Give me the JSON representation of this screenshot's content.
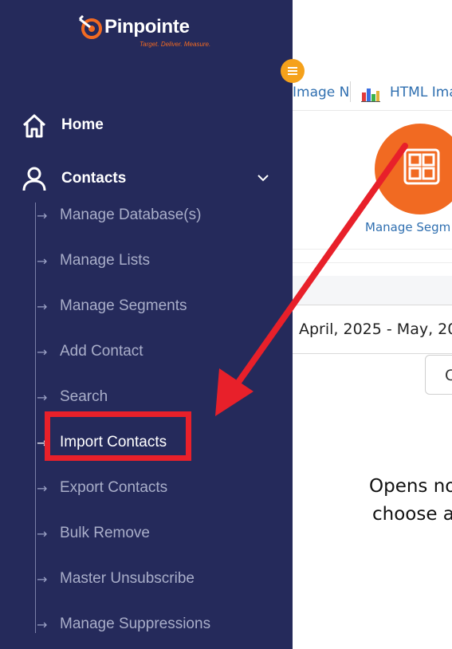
{
  "brand": {
    "name": "Pinpointe",
    "tagline": "Target. Deliver. Measure.",
    "accent_color": "#f16a22"
  },
  "sidebar": {
    "background_color": "#252a5b",
    "collapse_icon": "hamburger-icon",
    "main_items": [
      {
        "label": "Home",
        "icon": "home-icon"
      },
      {
        "label": "Contacts",
        "icon": "user-icon",
        "expanded": true,
        "chevron": "chevron-down-icon"
      }
    ],
    "contacts_submenu": [
      {
        "label": "Manage Database(s)"
      },
      {
        "label": "Manage Lists"
      },
      {
        "label": "Manage Segments"
      },
      {
        "label": "Add Contact"
      },
      {
        "label": "Search"
      },
      {
        "label": "Import Contacts",
        "active": true
      },
      {
        "label": "Export Contacts"
      },
      {
        "label": "Bulk Remove"
      },
      {
        "label": "Master Unsubscribe"
      },
      {
        "label": "Manage Suppressions"
      }
    ],
    "arrow_glyph": "→"
  },
  "toolbar": {
    "image_link": "Image N",
    "html_link": "HTML Ima",
    "chart_icon": "bar-chart-icon"
  },
  "shortcut": {
    "label": "Manage Segm",
    "icon": "segments-grid-icon",
    "circle_color": "#f16a22"
  },
  "report": {
    "date_range": "April, 2025 - May, 20",
    "button_label": "C",
    "message_line1": "Opens no",
    "message_line2": "choose a"
  },
  "annotation": {
    "highlight_color": "#e8202a",
    "highlighted_item": "Import Contacts"
  }
}
